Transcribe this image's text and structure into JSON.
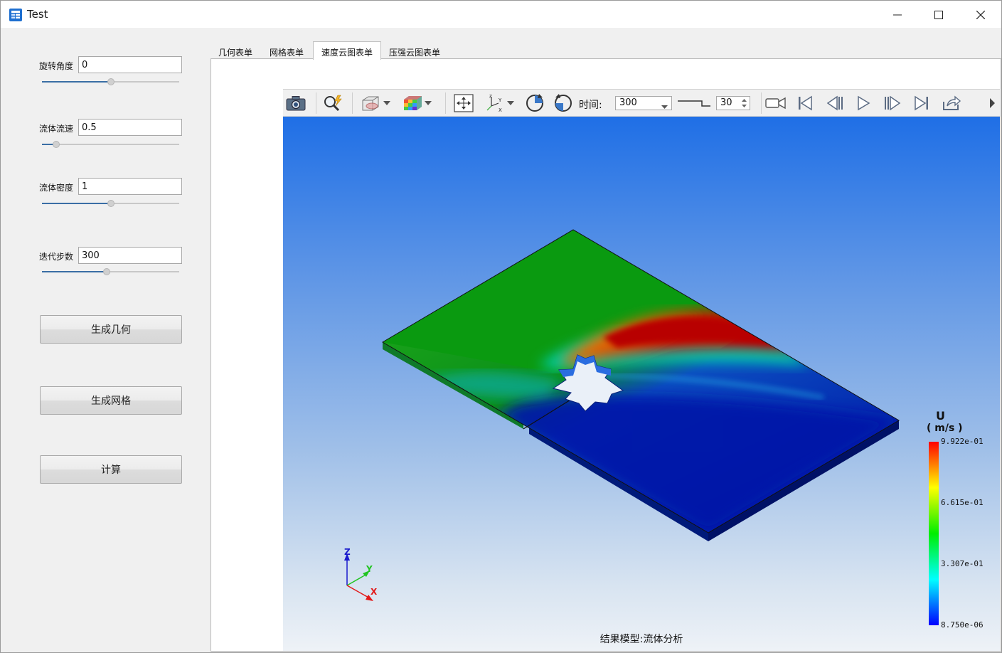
{
  "window": {
    "title": "Test",
    "app_icon": "table-app-icon"
  },
  "params": {
    "rotation": {
      "label": "旋转角度",
      "value": "0",
      "slider_fraction": 0.5
    },
    "flow_speed": {
      "label": "流体流速",
      "value": "0.5",
      "slider_fraction": 0.08
    },
    "density": {
      "label": "流体密度",
      "value": "1",
      "slider_fraction": 0.5
    },
    "iterations": {
      "label": "迭代步数",
      "value": "300",
      "slider_fraction": 0.47
    }
  },
  "buttons": {
    "gen_geometry": "生成几何",
    "gen_mesh": "生成网格",
    "compute": "计算"
  },
  "tabs": [
    {
      "label": "几何表单",
      "active": false
    },
    {
      "label": "网格表单",
      "active": false
    },
    {
      "label": "速度云图表单",
      "active": true
    },
    {
      "label": "压强云图表单",
      "active": false
    }
  ],
  "toolbar": {
    "time_label": "时间:",
    "time_value": "300",
    "step_value": "30",
    "icons": [
      "camera-icon",
      "zoom-icon",
      "display-mode-icon",
      "color-map-icon",
      "fit-view-icon",
      "axes-view-icon",
      "rotate-cw-icon",
      "rotate-ccw-icon",
      "record-icon",
      "first-frame-icon",
      "prev-frame-icon",
      "play-icon",
      "next-frame-icon",
      "last-frame-icon",
      "export-icon"
    ]
  },
  "legend": {
    "title": "U",
    "unit": "( m/s )",
    "ticks": [
      "9.922e-01",
      "6.615e-01",
      "3.307e-01",
      "8.750e-06"
    ],
    "colors": [
      "#ff0000",
      "#ffff00",
      "#00ff00",
      "#00ffff",
      "#0000ff"
    ]
  },
  "axes": {
    "x": "X",
    "y": "Y",
    "z": "Z"
  },
  "footer": "结果模型:流体分析",
  "colors": {
    "accent": "#3a6ea5"
  }
}
